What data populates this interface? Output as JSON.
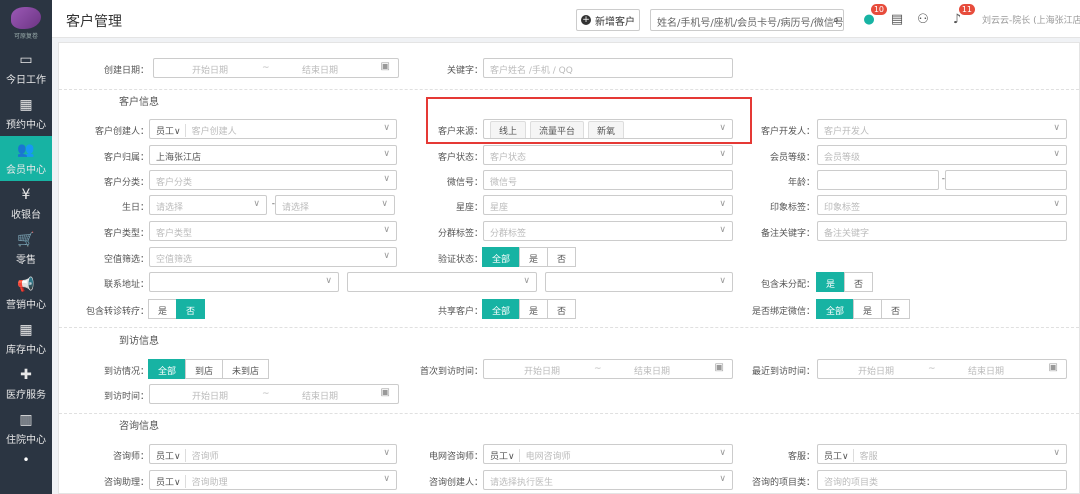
{
  "sidebar": {
    "logo_text": "可原复卷",
    "items": [
      {
        "label": "今日工作",
        "icon": "monitor-icon",
        "glyph": "▭"
      },
      {
        "label": "预约中心",
        "icon": "calendar-icon",
        "glyph": "▦"
      },
      {
        "label": "会员中心",
        "icon": "users-icon",
        "glyph": "👥"
      },
      {
        "label": "收银台",
        "icon": "yen-icon",
        "glyph": "¥"
      },
      {
        "label": "零售",
        "icon": "cart-icon",
        "glyph": "🛒"
      },
      {
        "label": "营销中心",
        "icon": "megaphone-icon",
        "glyph": "📢"
      },
      {
        "label": "库存中心",
        "icon": "grid-icon",
        "glyph": "▦"
      },
      {
        "label": "医疗服务",
        "icon": "medkit-icon",
        "glyph": "✚"
      },
      {
        "label": "住院中心",
        "icon": "building-icon",
        "glyph": "▥"
      }
    ],
    "more": "•"
  },
  "header": {
    "title": "客户管理",
    "new_button": "新增客户",
    "search_placeholder": "姓名/手机号/座机/会员卡号/病历号/微信号",
    "badge_chat": "10",
    "badge_bell": "11",
    "user": "刘云云-院长 (上海张江店)"
  },
  "filters": {
    "create_date": {
      "label": "创建日期：",
      "start": "开始日期",
      "sep": "~",
      "end": "结束日期"
    },
    "keyword": {
      "label": "关键字：",
      "placeholder": "客户姓名 /手机 / QQ"
    },
    "sections": {
      "customer": "客户信息",
      "visit": "到访信息",
      "consult": "咨询信息"
    },
    "creator": {
      "label": "客户创建人：",
      "emp": "员工∨",
      "placeholder": "客户创建人"
    },
    "source": {
      "label": "客户来源：",
      "tags": [
        "线上",
        "流量平台",
        "新氧"
      ]
    },
    "developer": {
      "label": "客户开发人：",
      "placeholder": "客户开发人"
    },
    "belong": {
      "label": "客户归属：",
      "value": "上海张江店"
    },
    "status": {
      "label": "客户状态：",
      "placeholder": "客户状态"
    },
    "level": {
      "label": "会员等级：",
      "placeholder": "会员等级"
    },
    "category": {
      "label": "客户分类：",
      "placeholder": "客户分类"
    },
    "wechat": {
      "label": "微信号：",
      "placeholder": "微信号"
    },
    "age": {
      "label": "年龄：",
      "sep": "-"
    },
    "birthday": {
      "label": "生日：",
      "ph1": "请选择",
      "sep": "-",
      "ph2": "请选择"
    },
    "zodiac": {
      "label": "星座：",
      "placeholder": "星座"
    },
    "impression": {
      "label": "印象标签：",
      "placeholder": "印象标签"
    },
    "ctype": {
      "label": "客户类型：",
      "placeholder": "客户类型"
    },
    "group": {
      "label": "分群标签：",
      "placeholder": "分群标签"
    },
    "remark": {
      "label": "备注关键字：",
      "placeholder": "备注关键字"
    },
    "empty_filter": {
      "label": "空值筛选：",
      "placeholder": "空值筛选"
    },
    "verify": {
      "label": "验证状态：",
      "options": [
        "全部",
        "是",
        "否"
      ]
    },
    "address": {
      "label": "联系地址："
    },
    "unassigned": {
      "label": "包含未分配：",
      "options": [
        "是",
        "否"
      ]
    },
    "transfer": {
      "label": "包含转诊转疗：",
      "options": [
        "是",
        "否"
      ]
    },
    "shared": {
      "label": "共享客户：",
      "options": [
        "全部",
        "是",
        "否"
      ]
    },
    "bound_wechat": {
      "label": "是否绑定微信：",
      "options": [
        "全部",
        "是",
        "否"
      ]
    },
    "visit_state": {
      "label": "到访情况：",
      "options": [
        "全部",
        "到店",
        "未到店"
      ]
    },
    "first_visit": {
      "label": "首次到访时间：",
      "start": "开始日期",
      "sep": "~",
      "end": "结束日期"
    },
    "last_visit": {
      "label": "最近到访时间：",
      "start": "开始日期",
      "sep": "~",
      "end": "结束日期"
    },
    "visit_time": {
      "label": "到访时间：",
      "start": "开始日期",
      "sep": "~",
      "end": "结束日期"
    },
    "consultant": {
      "label": "咨询师：",
      "emp": "员工∨",
      "placeholder": "咨询师"
    },
    "net_consultant": {
      "label": "电网咨询师：",
      "emp": "员工∨",
      "placeholder": "电网咨询师"
    },
    "service": {
      "label": "客服：",
      "emp": "员工∨",
      "placeholder": "客服"
    },
    "assistant": {
      "label": "咨询助理：",
      "emp": "员工∨",
      "placeholder": "咨询助理"
    },
    "consult_creator": {
      "label": "咨询创建人：",
      "placeholder": "请选择执行医生"
    },
    "consult_items": {
      "label": "咨询的项目类：",
      "placeholder": "咨询的项目类"
    }
  }
}
